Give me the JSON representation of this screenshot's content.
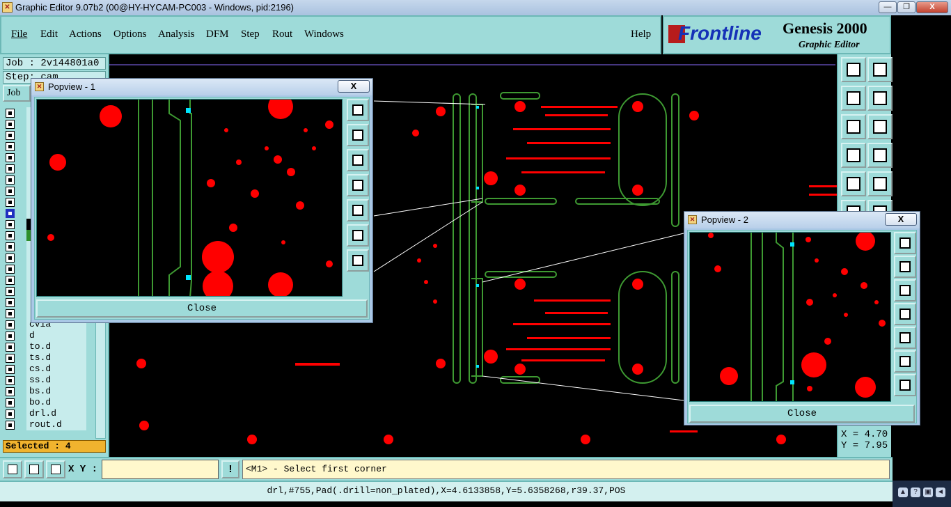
{
  "window": {
    "title": "Graphic Editor 9.07b2 (00@HY-HYCAM-PC003 - Windows, pid:2196)",
    "minimize_glyph": "—",
    "maximize_glyph": "❐",
    "close_glyph": "X"
  },
  "menu": {
    "file": "File",
    "edit": "Edit",
    "actions": "Actions",
    "options": "Options",
    "analysis": "Analysis",
    "dfm": "DFM",
    "step": "Step",
    "rout": "Rout",
    "windows": "Windows",
    "help": "Help"
  },
  "brand": {
    "logo": "Frontline",
    "product": "Genesis 2000",
    "subtitle": "Graphic Editor"
  },
  "left_panel": {
    "job_field": "Job : 2v144801a0",
    "step_field": "Step: cam",
    "job_button": "Job",
    "layers": [
      {
        "name": "",
        "style": "normal"
      },
      {
        "name": "",
        "style": "normal"
      },
      {
        "name": "",
        "style": "normal"
      },
      {
        "name": "",
        "style": "normal"
      },
      {
        "name": "",
        "style": "normal"
      },
      {
        "name": "",
        "style": "normal"
      },
      {
        "name": "",
        "style": "normal"
      },
      {
        "name": "",
        "style": "normal"
      },
      {
        "name": "",
        "style": "normal"
      },
      {
        "name": "",
        "style": "normal"
      },
      {
        "name": "",
        "style": "normal"
      },
      {
        "name": "",
        "style": "normal"
      },
      {
        "name": "",
        "style": "normal"
      },
      {
        "name": "",
        "style": "normal"
      },
      {
        "name": "",
        "style": "normal"
      },
      {
        "name": "",
        "style": "normal"
      },
      {
        "name": "",
        "style": "normal"
      },
      {
        "name": "",
        "style": "normal"
      },
      {
        "name": "",
        "style": "normal"
      },
      {
        "name": "cvia",
        "style": "normal"
      },
      {
        "name": "d",
        "style": "normal"
      },
      {
        "name": "to.d",
        "style": "normal"
      },
      {
        "name": "ts.d",
        "style": "normal"
      },
      {
        "name": "cs.d",
        "style": "normal"
      },
      {
        "name": "ss.d",
        "style": "normal"
      },
      {
        "name": "bs.d",
        "style": "normal"
      },
      {
        "name": "bo.d",
        "style": "normal"
      },
      {
        "name": "drl.d",
        "style": "normal"
      },
      {
        "name": "rout.d",
        "style": "normal"
      }
    ],
    "selected_label": "Selected : 4"
  },
  "coordinates": {
    "x": "X = 4.70",
    "y": "Y = 7.95"
  },
  "bottom": {
    "xy_label": "X Y :",
    "xy_value": "",
    "warn_glyph": "!",
    "prompt": "<M1> - Select first corner",
    "status": "drl,#755,Pad(.drill=non_plated),X=4.6133858,Y=5.6358268,r39.37,POS"
  },
  "popup1": {
    "title": "Popview - 1",
    "close_x": "X",
    "close_button": "Close"
  },
  "popup2": {
    "title": "Popview - 2",
    "close_x": "X",
    "close_button": "Close"
  },
  "colors": {
    "panel": "#9edbd9",
    "pad": "#ff0000",
    "trace": "#3e9a32",
    "highlight": "#00e5ff",
    "selected_bg": "#f0b32e"
  }
}
